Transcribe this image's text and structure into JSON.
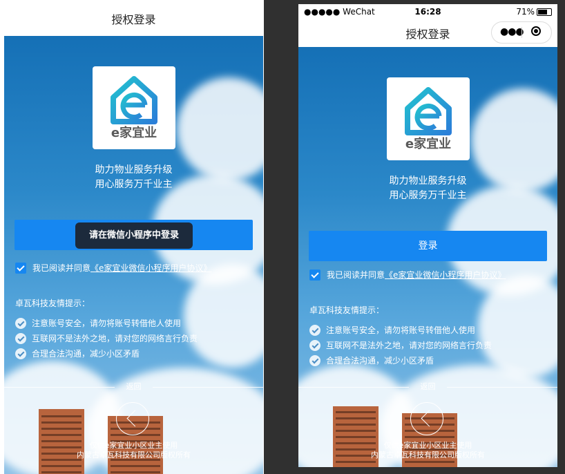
{
  "page_title": "授权登录",
  "status_bar": {
    "carrier": "●●●●● WeChat",
    "time": "16:28",
    "battery": "71%"
  },
  "capsule": {
    "more_icon": "more-dots-icon",
    "close_icon": "target-icon"
  },
  "logo": {
    "text": "e家宜业",
    "letter": "e"
  },
  "slogan": {
    "line1": "助力物业服务升级",
    "line2": "用心服务万千业主"
  },
  "left_screen": {
    "tooltip": "请在微信小程序中登录"
  },
  "right_screen": {
    "login_button": "登录"
  },
  "agreement": {
    "prefix": "我已阅读并同意",
    "link": "《e家宜业微信小程序用户协议》"
  },
  "tips": {
    "title": "卓瓦科技友情提示：",
    "items": [
      "注意账号安全，请勿将账号转借他人使用",
      "互联网不是法外之地，请对您的网络言行负责",
      "合理合法沟通，减少小区矛盾"
    ]
  },
  "back_label": "返回",
  "footer": {
    "line1": "仅供e家宜业小区业主使用",
    "line2": "内蒙古卓瓦科技有限公司版权所有"
  },
  "colors": {
    "primary": "#1687f1",
    "tooltip_bg": "#1c2a3c",
    "logo_teal": "#22c2cf",
    "logo_blue": "#2b7fd8"
  }
}
